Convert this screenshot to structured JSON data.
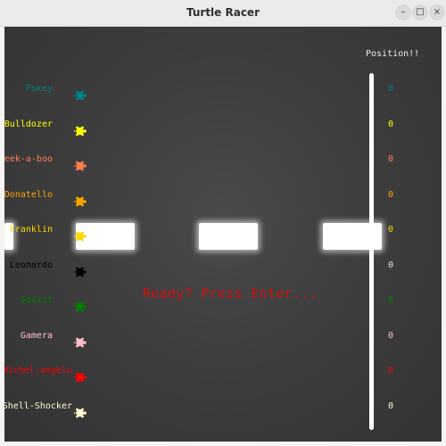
{
  "window": {
    "title": "Turtle Racer",
    "min_symbol": "–",
    "max_symbol": "□",
    "close_symbol": "×"
  },
  "race": {
    "position_header": "Position!!",
    "ready_message": "Ready? Press Enter...",
    "racers": [
      {
        "name": "Pokey",
        "color": "#008080",
        "position": "0"
      },
      {
        "name": "Bulldozer",
        "color": "#ffff00",
        "position": "0"
      },
      {
        "name": "Peek-a-boo",
        "color": "#ff7f50",
        "position": "0"
      },
      {
        "name": "Donatello",
        "color": "#ffa500",
        "position": "0"
      },
      {
        "name": "Franklin",
        "color": "#ffd700",
        "position": "0"
      },
      {
        "name": "Leonardo",
        "color": "#000000",
        "position": "0"
      },
      {
        "name": "Squirt",
        "color": "#008000",
        "position": "0"
      },
      {
        "name": "Gamera",
        "color": "#ffc0cb",
        "position": "0"
      },
      {
        "name": "Michel-angelo",
        "color": "#ff0000",
        "position": "0"
      },
      {
        "name": "Shell-Shocker",
        "color": "#fffdd0",
        "position": "0"
      }
    ]
  }
}
